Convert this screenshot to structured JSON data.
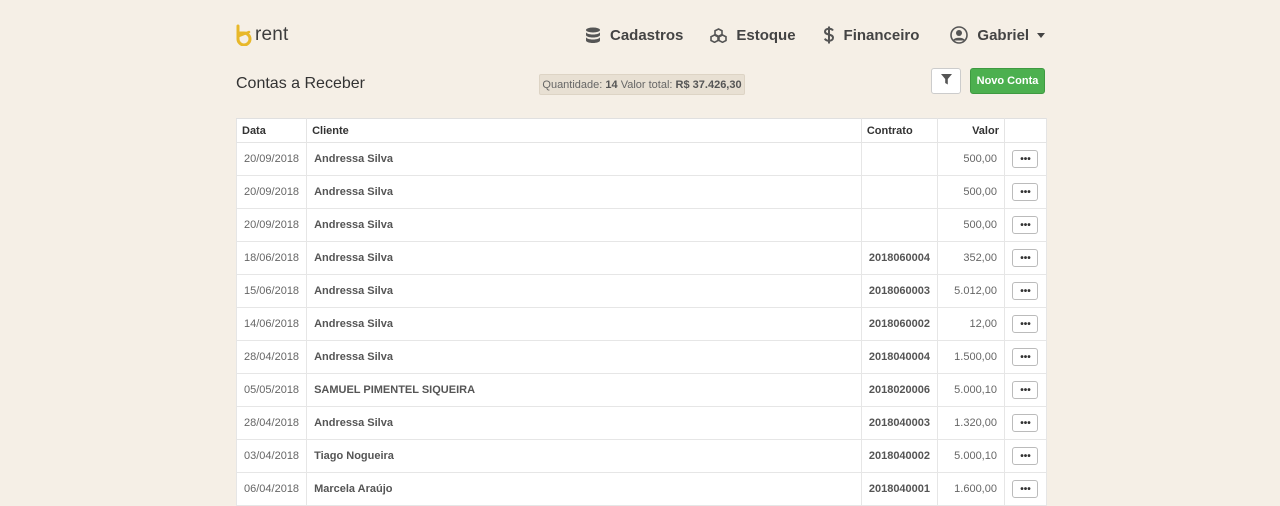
{
  "app": {
    "logo_text": "rent",
    "brand_color": "#e8b82a"
  },
  "nav": {
    "cadastros": {
      "label": "Cadastros",
      "icon": "database-icon"
    },
    "estoque": {
      "label": "Estoque",
      "icon": "cubes-icon"
    },
    "financeiro": {
      "label": "Financeiro",
      "icon": "dollar-icon"
    },
    "user": {
      "label": "Gabriel",
      "icon": "user-circle-icon"
    }
  },
  "page": {
    "title": "Contas a Receber",
    "summary": {
      "qty_label": "Quantidade:",
      "qty_value": "14",
      "total_label": "Valor total:",
      "total_value": "R$ 37.426,30"
    },
    "filter_icon": "filter-icon",
    "new_button_label": "Novo Conta",
    "accent_color": "#4cb04f"
  },
  "table": {
    "headers": {
      "date": "Data",
      "client": "Cliente",
      "contract": "Contrato",
      "value": "Valor"
    },
    "more_label": "•••",
    "rows": [
      {
        "date": "20/09/2018",
        "client": "Andressa Silva",
        "contract": "",
        "value": "500,00"
      },
      {
        "date": "20/09/2018",
        "client": "Andressa Silva",
        "contract": "",
        "value": "500,00"
      },
      {
        "date": "20/09/2018",
        "client": "Andressa Silva",
        "contract": "",
        "value": "500,00"
      },
      {
        "date": "18/06/2018",
        "client": "Andressa Silva",
        "contract": "2018060004",
        "value": "352,00"
      },
      {
        "date": "15/06/2018",
        "client": "Andressa Silva",
        "contract": "2018060003",
        "value": "5.012,00"
      },
      {
        "date": "14/06/2018",
        "client": "Andressa Silva",
        "contract": "2018060002",
        "value": "12,00"
      },
      {
        "date": "28/04/2018",
        "client": "Andressa Silva",
        "contract": "2018040004",
        "value": "1.500,00"
      },
      {
        "date": "05/05/2018",
        "client": "SAMUEL PIMENTEL SIQUEIRA",
        "contract": "2018020006",
        "value": "5.000,10"
      },
      {
        "date": "28/04/2018",
        "client": "Andressa Silva",
        "contract": "2018040003",
        "value": "1.320,00"
      },
      {
        "date": "03/04/2018",
        "client": "Tiago Nogueira",
        "contract": "2018040002",
        "value": "5.000,10"
      },
      {
        "date": "06/04/2018",
        "client": "Marcela Araújo",
        "contract": "2018040001",
        "value": "1.600,00"
      }
    ]
  }
}
